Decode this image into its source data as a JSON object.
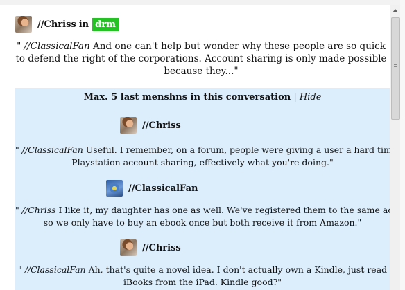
{
  "post": {
    "author": "//Chriss",
    "in_word": "in",
    "tag": "drm",
    "quote_open": "\"",
    "mention": "//ClassicalFan",
    "text": " And one can't help but wonder why these people are so quick to defend the right of the corporations. Account sharing is only made possible because they...\""
  },
  "conversation": {
    "title": "Max. 5 last menshns in this conversation",
    "divider": " | ",
    "hide_label": "Hide",
    "messages": [
      {
        "author": "//Chriss",
        "avatar": "chriss-avatar",
        "line1_prefix": "\" ",
        "mention": "//ClassicalFan",
        "line1_rest": " Useful. I remember, on a forum, people were giving a user a hard time for",
        "line2": "Playstation account sharing, effectively what you're doing.\""
      },
      {
        "author": "//ClassicalFan",
        "avatar": "classicalfan-avatar",
        "line1_prefix": "\" ",
        "mention": "//Chriss",
        "line1_rest": " I like it, my daughter has one as well. We've registered them to the same account",
        "line2": "so we only have to buy an ebook once but both receive it from Amazon.\""
      },
      {
        "author": "//Chriss",
        "avatar": "chriss-avatar",
        "line1_prefix": "\"  ",
        "mention": "//ClassicalFan",
        "line1_rest": " Ah, that's quite a novel idea. I don't actually own a Kindle, just read",
        "line2": "iBooks from the iPad. Kindle good?\""
      }
    ]
  }
}
